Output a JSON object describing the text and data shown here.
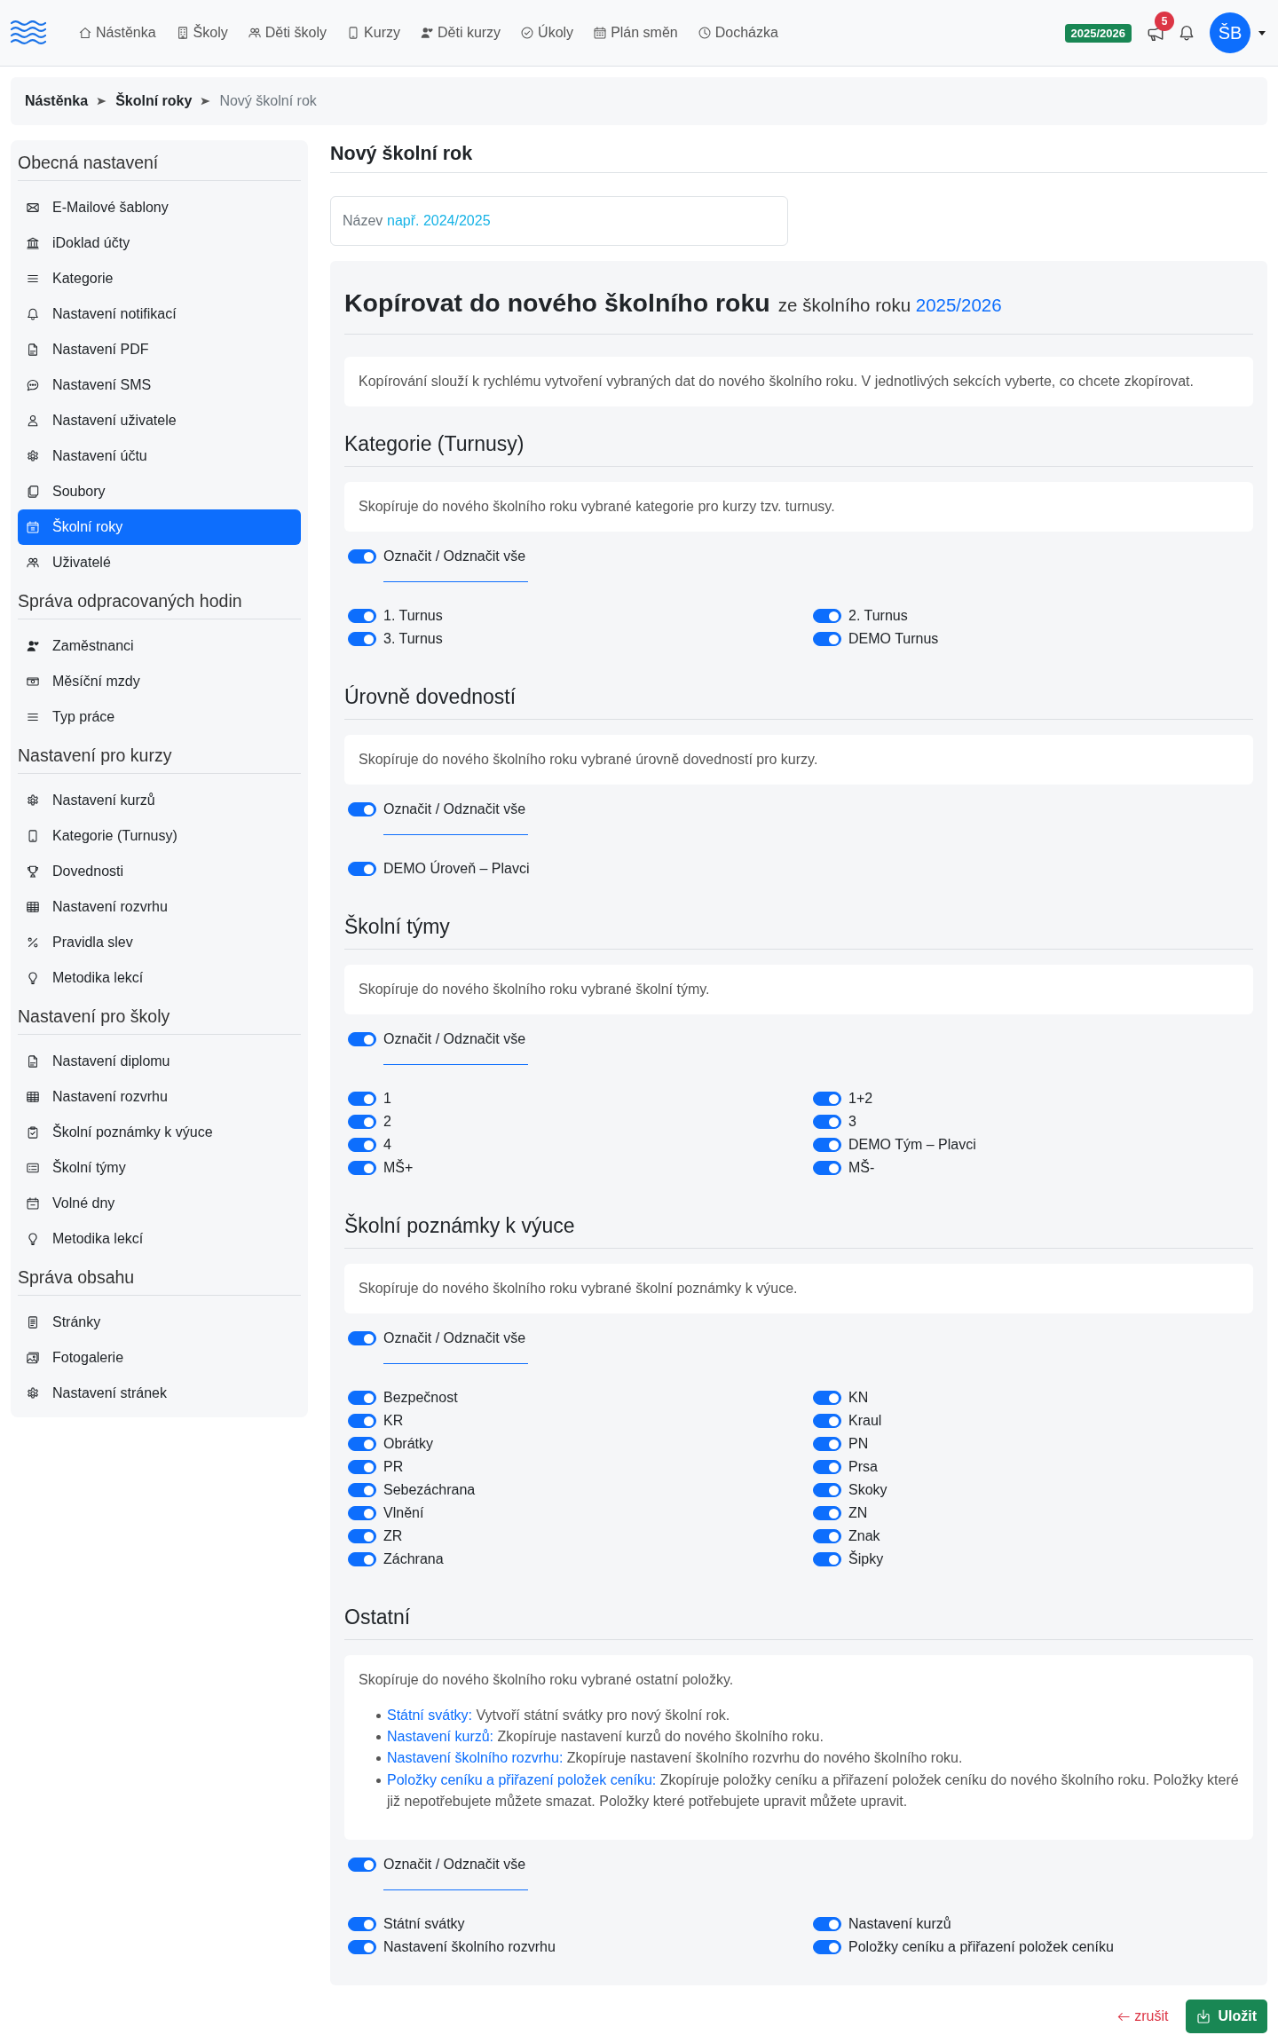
{
  "top_bar": {
    "nav": [
      "Nástěnka",
      "Školy",
      "Děti školy",
      "Kurzy",
      "Děti kurzy",
      "Úkoly",
      "Plán směn",
      "Docházka"
    ],
    "year_badge": "2025/2026",
    "announcements_count": "5",
    "avatar_initials": "ŠB"
  },
  "breadcrumb": [
    {
      "label": "Nástěnka",
      "current": false
    },
    {
      "label": "Školní roky",
      "current": false
    },
    {
      "label": "Nový školní rok",
      "current": true
    }
  ],
  "sidebar": {
    "sections": [
      {
        "title": "Obecná nastavení",
        "items": [
          {
            "label": "E-Mailové šablony",
            "selected": false
          },
          {
            "label": "iDoklad účty",
            "selected": false
          },
          {
            "label": "Kategorie",
            "selected": false
          },
          {
            "label": "Nastavení notifikací",
            "selected": false
          },
          {
            "label": "Nastavení PDF",
            "selected": false
          },
          {
            "label": "Nastavení SMS",
            "selected": false
          },
          {
            "label": "Nastavení uživatele",
            "selected": false
          },
          {
            "label": "Nastavení účtu",
            "selected": false
          },
          {
            "label": "Soubory",
            "selected": false
          },
          {
            "label": "Školní roky",
            "selected": true
          },
          {
            "label": "Uživatelé",
            "selected": false
          }
        ]
      },
      {
        "title": "Správa odpracovaných hodin",
        "items": [
          {
            "label": "Zaměstnanci",
            "selected": false
          },
          {
            "label": "Měsíční mzdy",
            "selected": false
          },
          {
            "label": "Typ práce",
            "selected": false
          }
        ]
      },
      {
        "title": "Nastavení pro kurzy",
        "items": [
          {
            "label": "Nastavení kurzů",
            "selected": false
          },
          {
            "label": "Kategorie (Turnusy)",
            "selected": false
          },
          {
            "label": "Dovednosti",
            "selected": false
          },
          {
            "label": "Nastavení rozvrhu",
            "selected": false
          },
          {
            "label": "Pravidla slev",
            "selected": false
          },
          {
            "label": "Metodika lekcí",
            "selected": false
          }
        ]
      },
      {
        "title": "Nastavení pro školy",
        "items": [
          {
            "label": "Nastavení diplomu",
            "selected": false
          },
          {
            "label": "Nastavení rozvrhu",
            "selected": false
          },
          {
            "label": "Školní poznámky k výuce",
            "selected": false
          },
          {
            "label": "Školní týmy",
            "selected": false
          },
          {
            "label": "Volné dny",
            "selected": false
          },
          {
            "label": "Metodika lekcí",
            "selected": false
          }
        ]
      },
      {
        "title": "Správa obsahu",
        "items": [
          {
            "label": "Stránky",
            "selected": false
          },
          {
            "label": "Fotogalerie",
            "selected": false
          },
          {
            "label": "Nastavení stránek",
            "selected": false
          }
        ]
      }
    ]
  },
  "page": {
    "title": "Nový školní rok",
    "name_field": {
      "label": "Název",
      "placeholder": "např. 2024/2025"
    }
  },
  "copy_panel": {
    "title": "Kopírovat do nového školního roku",
    "subtitle": "ze školního roku",
    "source_year": "2025/2026",
    "intro": "Kopírování slouží k rychlému vytvoření vybraných dat do nového školního roku. V jednotlivých sekcích vyberte, co chcete zkopírovat.",
    "sections": [
      {
        "heading": "Kategorie (Turnusy)",
        "description": "Skopíruje do nového školního roku vybrané kategorie pro kurzy tzv. turnusy.",
        "select_all": {
          "label": "Označit / Odznačit vše",
          "on": true
        },
        "items": [
          {
            "label": "1. Turnus",
            "on": true
          },
          {
            "label": "2. Turnus",
            "on": true
          },
          {
            "label": "3. Turnus",
            "on": true
          },
          {
            "label": "DEMO Turnus",
            "on": true
          }
        ]
      },
      {
        "heading": "Úrovně dovedností",
        "description": "Skopíruje do nového školního roku vybrané úrovně dovedností pro kurzy.",
        "select_all": {
          "label": "Označit / Odznačit vše",
          "on": true
        },
        "items": [
          {
            "label": "DEMO Úroveň – Plavci",
            "on": true
          }
        ]
      },
      {
        "heading": "Školní týmy",
        "description": "Skopíruje do nového školního roku vybrané školní týmy.",
        "select_all": {
          "label": "Označit / Odznačit vše",
          "on": true
        },
        "items": [
          {
            "label": "1",
            "on": true
          },
          {
            "label": "1+2",
            "on": true
          },
          {
            "label": "2",
            "on": true
          },
          {
            "label": "3",
            "on": true
          },
          {
            "label": "4",
            "on": true
          },
          {
            "label": "DEMO Tým – Plavci",
            "on": true
          },
          {
            "label": "MŠ+",
            "on": true
          },
          {
            "label": "MŠ-",
            "on": true
          }
        ]
      },
      {
        "heading": "Školní poznámky k výuce",
        "description": "Skopíruje do nového školního roku vybrané školní poznámky k výuce.",
        "select_all": {
          "label": "Označit / Odznačit vše",
          "on": true
        },
        "items": [
          {
            "label": "Bezpečnost",
            "on": true
          },
          {
            "label": "KN",
            "on": true
          },
          {
            "label": "KR",
            "on": true
          },
          {
            "label": "Kraul",
            "on": true
          },
          {
            "label": "Obrátky",
            "on": true
          },
          {
            "label": "PN",
            "on": true
          },
          {
            "label": "PR",
            "on": true
          },
          {
            "label": "Prsa",
            "on": true
          },
          {
            "label": "Sebezáchrana",
            "on": true
          },
          {
            "label": "Skoky",
            "on": true
          },
          {
            "label": "Vlnění",
            "on": true
          },
          {
            "label": "ZN",
            "on": true
          },
          {
            "label": "ZR",
            "on": true
          },
          {
            "label": "Znak",
            "on": true
          },
          {
            "label": "Záchrana",
            "on": true
          },
          {
            "label": "Šipky",
            "on": true
          }
        ]
      },
      {
        "heading": "Ostatní",
        "description": "Skopíruje do nového školního roku vybrané ostatní položky.",
        "bullets": [
          {
            "term": "Státní svátky:",
            "text": "Vytvoří státní svátky pro nový školní rok."
          },
          {
            "term": "Nastavení kurzů:",
            "text": "Zkopíruje nastavení kurzů do nového školního roku."
          },
          {
            "term": "Nastavení školního rozvrhu:",
            "text": "Zkopíruje nastavení školního rozvrhu do nového školního roku."
          },
          {
            "term": "Položky ceníku a přiřazení položek ceníku:",
            "text": "Zkopíruje položky ceníku a přiřazení položek ceníku do nového školního roku. Položky které již nepotřebujete můžete smazat. Položky které potřebujete upravit můžete upravit."
          }
        ],
        "select_all": {
          "label": "Označit / Odznačit vše",
          "on": true
        },
        "items": [
          {
            "label": "Státní svátky",
            "on": true
          },
          {
            "label": "Nastavení kurzů",
            "on": true
          },
          {
            "label": "Nastavení školního rozvrhu",
            "on": true
          },
          {
            "label": "Položky ceníku a přiřazení položek ceníku",
            "on": true
          }
        ]
      }
    ]
  },
  "actions": {
    "cancel": "zrušit",
    "save": "Uložit"
  }
}
